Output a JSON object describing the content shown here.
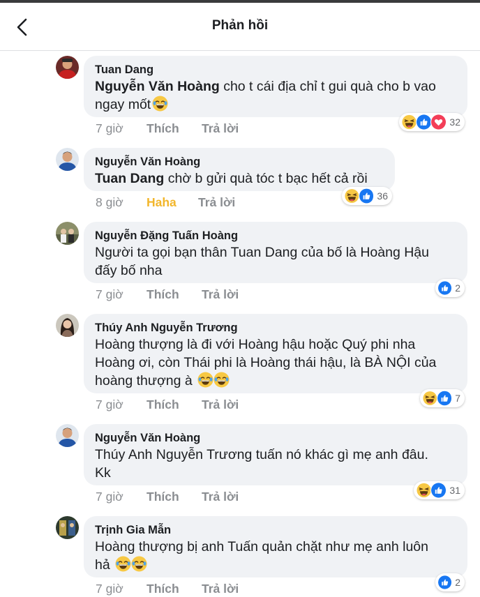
{
  "header": {
    "title": "Phản hồi"
  },
  "comments": [
    {
      "author": "Tuan Dang",
      "mention": "Nguyễn Văn Hoàng",
      "line1": " cho t cái địa chỉ t gui quà cho b vao",
      "line2": "ngay mốt",
      "time": "7 giờ",
      "like": "Thích",
      "reply": "Trả lời",
      "reaction_count": "32"
    },
    {
      "author": "Nguyễn Văn Hoàng",
      "mention": "Tuan Dang",
      "line1": " chờ b gửi quà tóc t bạc hết cả rồi",
      "time": "8 giờ",
      "like": "Haha",
      "reply": "Trả lời",
      "reaction_count": "36"
    },
    {
      "author": "Nguyễn Đặng Tuấn Hoàng",
      "line1": "Người ta gọi bạn thân Tuan Dang của bố là Hoàng Hậu",
      "line2": "đấy bố nha",
      "time": "7 giờ",
      "like": "Thích",
      "reply": "Trả lời",
      "reaction_count": "2"
    },
    {
      "author": "Thúy Anh Nguyễn Trương",
      "line1": "Hoàng thượng là đi với Hoàng hậu hoặc Quý phi nha",
      "line2": "Hoàng ơi, còn Thái phi là Hoàng thái hậu, là BÀ NỘI của",
      "line3": "hoàng thượng à",
      "time": "7 giờ",
      "like": "Thích",
      "reply": "Trả lời",
      "reaction_count": "7"
    },
    {
      "author": "Nguyễn Văn Hoàng",
      "line1": "Thúy Anh Nguyễn Trương tuấn nó khác gì mẹ anh đâu.",
      "line2": "Kk",
      "time": "7 giờ",
      "like": "Thích",
      "reply": "Trả lời",
      "reaction_count": "31"
    },
    {
      "author": "Trịnh Gia Mẫn",
      "line1": "Hoàng thượng bị anh Tuấn quản chặt như mẹ anh luôn",
      "line2": "hả",
      "time": "7 giờ",
      "like": "Thích",
      "reply": "Trả lời",
      "reaction_count": "2"
    }
  ],
  "colors": {
    "like_blue": "#1877f2",
    "love_red": "#f33e58",
    "haha_yellow": "#f7b125"
  }
}
